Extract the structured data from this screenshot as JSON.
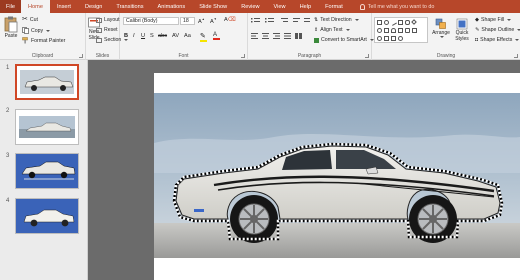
{
  "tabs": {
    "file": "File",
    "home": "Home",
    "insert": "Insert",
    "design": "Design",
    "transitions": "Transitions",
    "animations": "Animations",
    "slideshow": "Slide Show",
    "review": "Review",
    "view": "View",
    "help": "Help",
    "format": "Format",
    "tellme": "Tell me what you want to do"
  },
  "clipboard": {
    "paste": "Paste",
    "cut": "Cut",
    "copy": "Copy",
    "format_painter": "Format Painter",
    "label": "Clipboard"
  },
  "slides_group": {
    "new_slide": "New",
    "new_slide_2": "Slide",
    "layout": "Layout",
    "reset": "Reset",
    "section": "Section",
    "label": "Slides"
  },
  "font": {
    "name": "Calibri (Body)",
    "size": "18",
    "label": "Font"
  },
  "paragraph": {
    "text_direction": "Text Direction",
    "align_text": "Align Text",
    "smartart": "Convert to SmartArt",
    "label": "Paragraph"
  },
  "drawing": {
    "arrange": "Arrange",
    "quick": "Quick",
    "styles": "Styles",
    "shape_fill": "Shape Fill",
    "shape_outline": "Shape Outline",
    "shape_effects": "Shape Effects",
    "label": "Drawing"
  },
  "thumbnails": [
    {
      "num": "1"
    },
    {
      "num": "2"
    },
    {
      "num": "3"
    },
    {
      "num": "4"
    }
  ],
  "colors": {
    "accent": "#b7472a",
    "selected_thumb": "#d04726",
    "sky": "#a9bccd",
    "car_body": "#e8e7e2",
    "thumb_blue": "#3a63b8"
  }
}
